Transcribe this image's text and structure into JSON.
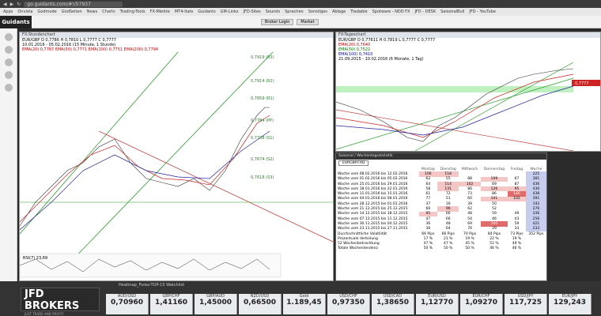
{
  "browser": {
    "url": "go.guidants.com/#!/57937"
  },
  "bookmarks": [
    "Apps",
    "Onvista",
    "Godmode",
    "GodSeiten",
    "News",
    "Charts",
    "Trading-Tools",
    "FX-Märkte",
    "MT4-Itats",
    "Guidants",
    "GM-Links",
    "JFD-Sites",
    "Sounds",
    "Sprachen",
    "Sonstiges",
    "Ablage",
    "Tradable",
    "Spotware - NDD FX",
    "JFD - DESK",
    "SaisonalBull",
    "JFD - YouTube"
  ],
  "toolbar": {
    "brand": "Guidants",
    "login": "Broker Login",
    "market": "Market"
  },
  "left_chart": {
    "title": "FX-Stundenchart",
    "legend1": "EUR/GBP  O 0,7786  H 0,7810  L 0,7777  C 0,7777",
    "legend2": "10.01.2016 - 05.02.2016 (15 Minute, 1 Stunde)",
    "legend3": "EMA(20) 0,7787   EMA(50) 0,7771   EMA(100) 0,7751   EMA(200) 0,7794",
    "levels": [
      "0,7919 (R3)",
      "0,7914 (R2)",
      "0,7859 (R1)",
      "0,7784 (PP)",
      "0,7738 (S1)",
      "0,7674 (S2)",
      "0,7618 (S3)"
    ],
    "rsi": "RSI(7) 23,69"
  },
  "right_chart": {
    "title": "FX-Tageschart",
    "legend1": "EUR/GBP  O 0,77611  H 0,7819  L 0,7777  C 0,7777",
    "legend2": "EMA(20) 0,7640",
    "legend3": "EMA(50) 0,7522",
    "legend4": "EMA(100) 0,7410",
    "legend5": "21.09.2015 - 10.02.2016 (6 Monate, 1 Tag)",
    "price_tag": "0,7777"
  },
  "stats": {
    "title": "Saisonal / Wochentagsstatistik",
    "symbol": "EURGBP.FXD",
    "headers": [
      "",
      "Montag",
      "Dienstag",
      "Mittwoch",
      "Donnerstag",
      "Freitag",
      "Woche"
    ],
    "rows": [
      [
        "Woche vom 08.02.2016 bis 12.02.2016",
        "106",
        "118",
        "",
        "",
        "",
        "225"
      ],
      [
        "Woche vom 01.02.2016 bis 05.02.2016",
        "62",
        "55",
        "88",
        "109",
        "67",
        "381"
      ],
      [
        "Woche vom 25.01.2016 bis 29.01.2016",
        "64",
        "114",
        "102",
        "69",
        "87",
        "436"
      ],
      [
        "Woche vom 18.01.2016 bis 22.01.2016",
        "58",
        "131",
        "86",
        "126",
        "95",
        "436"
      ],
      [
        "Woche vom 11.01.2016 bis 15.01.2016",
        "61",
        "72",
        "73",
        "86",
        "146",
        "438"
      ],
      [
        "Woche vom 04.01.2016 bis 08.01.2016",
        "77",
        "51",
        "60",
        "101",
        "102",
        "391"
      ],
      [
        "Woche vom 28.12.2015 bis 01.01.2016",
        "37",
        "16",
        "39",
        "50",
        "",
        "142"
      ],
      [
        "Woche vom 21.12.2015 bis 25.12.2015",
        "66",
        "96",
        "62",
        "52",
        "",
        "276"
      ],
      [
        "Woche vom 14.12.2015 bis 18.12.2015",
        "95",
        "66",
        "48",
        "59",
        "49",
        "336"
      ],
      [
        "Woche vom 07.12.2015 bis 11.12.2015",
        "47",
        "66",
        "54",
        "46",
        "43",
        "256"
      ],
      [
        "Woche vom 30.11.2015 bis 04.12.2015",
        "36",
        "48",
        "69",
        "200",
        "59",
        "421"
      ],
      [
        "Woche vom 23.11.2015 bis 27.11.2015",
        "36",
        "64",
        "76",
        "29",
        "33",
        "233"
      ]
    ],
    "summary_headers": [
      "",
      "Durchschnittliche Volatilität",
      "66 Pips",
      "66 Pips",
      "70 Pips",
      "84 Pips",
      "73 Pips",
      "352 Pips"
    ],
    "summary": [
      [
        "Prozentuale Verteilung",
        "17 %",
        "21 %",
        "19 %",
        "22 %",
        "19 %",
        ""
      ],
      [
        "52 Wochenbetrachtung",
        "47 %",
        "47 %",
        "45 %",
        "51 %",
        "49 %",
        ""
      ],
      [
        "Totale Wochentendenz",
        "50 %",
        "50 %",
        "50 %",
        "46 %",
        "46 %",
        ""
      ]
    ]
  },
  "heatmap": {
    "title": "Heatmap_Forex-TOP-15 Watchlist",
    "broker": "JFD BROKERS",
    "broker_tagline": "JUST TRADE AND PROFIT",
    "tickers": [
      {
        "name": "AUD/USD",
        "value": "0,70960"
      },
      {
        "name": "GBP/CHF",
        "value": "1,41160"
      },
      {
        "name": "GBP/AUD",
        "value": "1,45000"
      },
      {
        "name": "NZD/USD",
        "value": "0,66500"
      },
      {
        "name": "Gold",
        "value": "1.189,45"
      },
      {
        "name": "USD/CHF",
        "value": "0,97350"
      },
      {
        "name": "USD/CAD",
        "value": "1,38650"
      },
      {
        "name": "EUR/USD",
        "value": "1,12770"
      },
      {
        "name": "EUR/CHF",
        "value": "1,09270"
      },
      {
        "name": "USD/JPY",
        "value": "117,725"
      },
      {
        "name": "EUR/JPY",
        "value": "129,243"
      }
    ]
  }
}
